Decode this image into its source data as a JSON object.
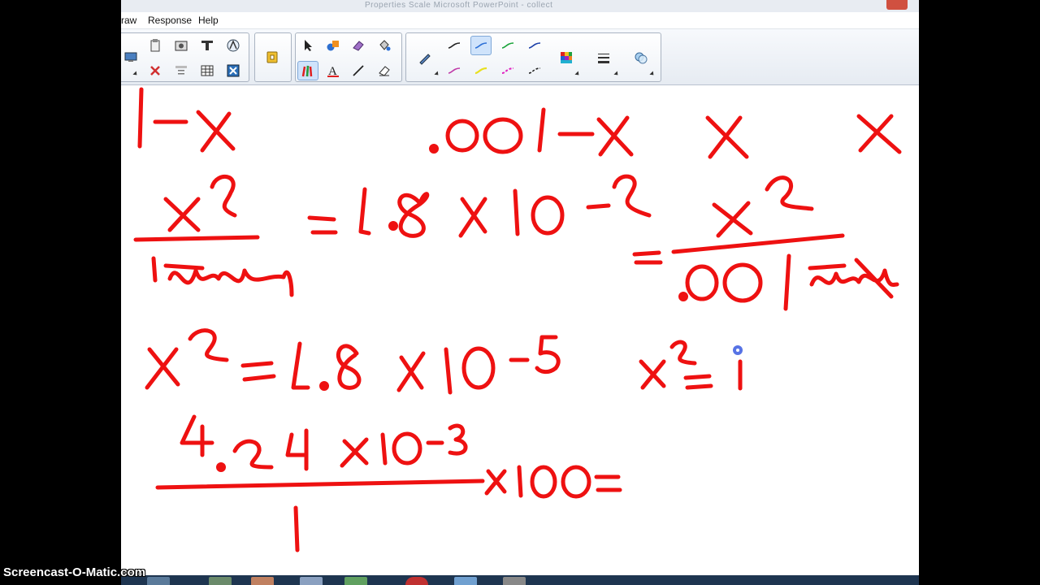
{
  "menu": {
    "items": [
      "raw",
      "Response",
      "Help"
    ]
  },
  "titlebar": {
    "text": "Properties Scale Microsoft PowerPoint - collect"
  },
  "toolbar": {
    "icons": [
      "camera-icon",
      "screenshot-icon",
      "text-icon",
      "clipart-icon",
      "delete-icon",
      "layout-icon",
      "table-icon",
      "close-box-icon",
      "attach-icon",
      "select-icon",
      "shapes-icon",
      "eraser-icon",
      "fill-icon",
      "pens-icon",
      "text-tool-icon",
      "line-icon",
      "eraser-tool-icon",
      "pen-icon",
      "color-palette-icon",
      "line-width-icon",
      "fill-effects-icon"
    ]
  },
  "pen_colors": {
    "black": "#222222",
    "blue": "#2b6fd6",
    "green": "#1aa33a",
    "navy": "#1b3fa8",
    "magenta": "#c03aa8",
    "yellow": "#e8e020",
    "pink": "#e020c0"
  },
  "ink_color": "#ee1111",
  "watermark": "Screencast-O-Matic.com"
}
